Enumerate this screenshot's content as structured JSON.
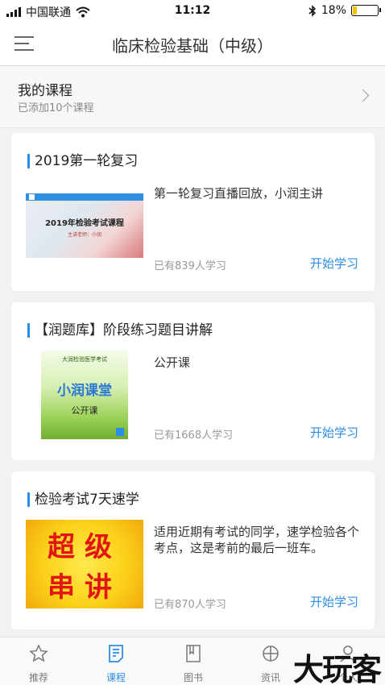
{
  "status_bar": {
    "carrier": "中国联通",
    "time": "11:12",
    "battery": "18%",
    "battery_level": 0.18
  },
  "header": {
    "title": "临床检验基础（中级）"
  },
  "my_courses": {
    "title": "我的课程",
    "subtitle": "已添加10个课程"
  },
  "courses": [
    {
      "title": "2019第一轮复习",
      "description": "第一轮复习直播回放，小润主讲",
      "count": "已有839人学习",
      "action": "开始学习",
      "thumb": {
        "text": "2019年检验考试课程",
        "sub": "主讲老师：小润"
      }
    },
    {
      "title": "【润题库】阶段练习题目讲解",
      "description": "公开课",
      "count": "已有1668人学习",
      "action": "开始学习",
      "thumb": {
        "top": "大润检验医学考试",
        "main": "小润课堂",
        "sub": "公开课"
      }
    },
    {
      "title": "检验考试7天速学",
      "description": "适用近期有考试的同学，速学检验各个考点，这是考前的最后一班车。",
      "count": "已有870人学习",
      "action": "开始学习",
      "thumb": {
        "line1": "超级",
        "line2": "串讲"
      }
    }
  ],
  "tabs": [
    {
      "label": "推荐",
      "icon": "star-icon",
      "active": false
    },
    {
      "label": "课程",
      "icon": "course-icon",
      "active": true
    },
    {
      "label": "图书",
      "icon": "book-icon",
      "active": false
    },
    {
      "label": "资讯",
      "icon": "globe-icon",
      "active": false
    },
    {
      "label": "个人",
      "icon": "person-icon",
      "active": false
    }
  ],
  "watermark": "大玩客",
  "colors": {
    "accent": "#2b8de6",
    "battery": "#f5c400"
  }
}
